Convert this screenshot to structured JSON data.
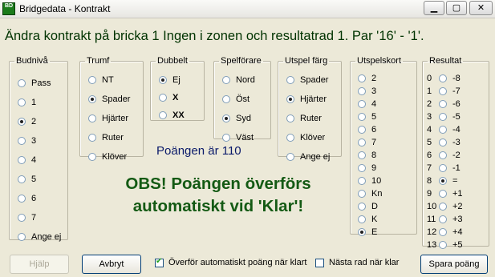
{
  "window": {
    "title": "Bridgedata - Kontrakt",
    "icon_letters": "BD"
  },
  "headline": "Ändra kontrakt på bricka 1 Ingen i zonen och resultatrad 1. Par '16' - '1'.",
  "groups": {
    "budniva": {
      "legend": "Budnivå",
      "options": [
        "Pass",
        "1",
        "2",
        "3",
        "4",
        "5",
        "6",
        "7",
        "Ange ej"
      ],
      "selected": "2"
    },
    "trumf": {
      "legend": "Trumf",
      "options": [
        "NT",
        "Spader",
        "Hjärter",
        "Ruter",
        "Klöver"
      ],
      "selected": "Spader"
    },
    "dubbelt": {
      "legend": "Dubbelt",
      "options": [
        "Ej",
        "X",
        "XX"
      ],
      "selected": "Ej"
    },
    "spelforare": {
      "legend": "Spelförare",
      "options": [
        "Nord",
        "Öst",
        "Syd",
        "Väst"
      ],
      "selected": "Syd"
    },
    "utspel_farg": {
      "legend": "Utspel färg",
      "options": [
        "Spader",
        "Hjärter",
        "Ruter",
        "Klöver",
        "Ange ej"
      ],
      "selected": "Hjärter"
    },
    "utspelskort": {
      "legend": "Utspelskort",
      "options": [
        "2",
        "3",
        "4",
        "5",
        "6",
        "7",
        "8",
        "9",
        "10",
        "Kn",
        "D",
        "K",
        "E"
      ],
      "selected": "E"
    },
    "resultat": {
      "legend": "Resultat",
      "numbers": [
        "0",
        "1",
        "2",
        "3",
        "4",
        "5",
        "6",
        "7",
        "8",
        "9",
        "10",
        "11",
        "12",
        "13"
      ],
      "labels": [
        "-8",
        "-7",
        "-6",
        "-5",
        "-4",
        "-3",
        "-2",
        "-1",
        "=",
        "+1",
        "+2",
        "+3",
        "+4",
        "+5"
      ],
      "selected": "="
    }
  },
  "points_text": "Poängen är 110",
  "obs_text": {
    "line1": "OBS! Poängen överförs",
    "line2": "automatiskt vid 'Klar'!"
  },
  "buttons": {
    "help": "Hjälp",
    "cancel": "Avbryt",
    "save": "Spara poäng"
  },
  "checkboxes": {
    "auto_transfer": {
      "label": "Överför automatiskt poäng när klart",
      "checked": true
    },
    "next_row": {
      "label": "Nästa rad när klar",
      "checked": false
    }
  },
  "colors": {
    "headline": "#003300",
    "points": "#0a1a6a",
    "obs": "#145a14"
  }
}
